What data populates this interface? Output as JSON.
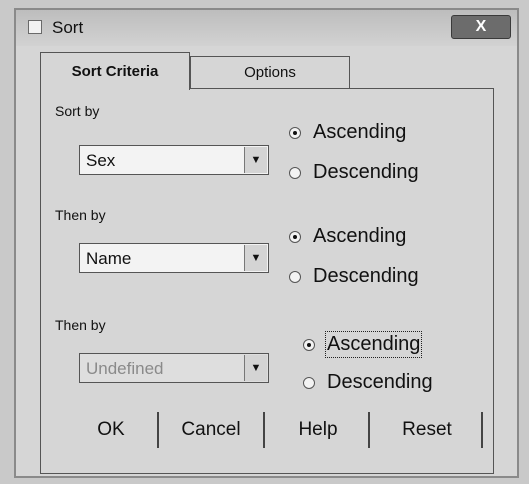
{
  "window": {
    "title": "Sort",
    "close_label": "X"
  },
  "tabs": [
    {
      "label": "Sort Criteria",
      "active": true
    },
    {
      "label": "Options",
      "active": false
    }
  ],
  "groups": [
    {
      "label": "Sort by",
      "value": "Sex",
      "disabled": false,
      "ascending": "Ascending",
      "descending": "Descending",
      "selected": "Ascending"
    },
    {
      "label": "Then by",
      "value": "Name",
      "disabled": false,
      "ascending": "Ascending",
      "descending": "Descending",
      "selected": "Ascending"
    },
    {
      "label": "Then by",
      "value": "Undefined",
      "disabled": true,
      "ascending": "Ascending",
      "descending": "Descending",
      "selected": "Ascending"
    }
  ],
  "buttons": {
    "ok": "OK",
    "cancel": "Cancel",
    "help": "Help",
    "reset": "Reset"
  }
}
